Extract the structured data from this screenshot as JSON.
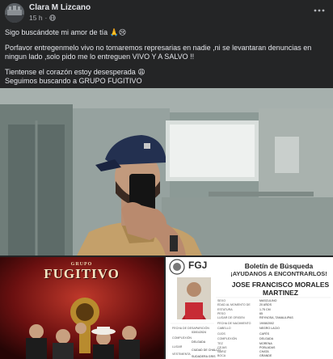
{
  "post": {
    "author": "Clara M Lizcano",
    "time": "15 h",
    "separator": "·",
    "paragraphs": [
      "Sigo buscándote mi amor de tía 🙏😢",
      "Porfavor entregenmelo vivo no tomaremos represarias en nadie ,ni se levantaran denuncias en ningun lado ,solo pido me lo entreguen VIVO Y A SALVO !!",
      "Tientense el corazón estoy desesperada 😩\nSeguimos buscando a GRUPO FUGITIVO"
    ]
  },
  "band_image": {
    "title_top": "GRUPO",
    "title_main": "FUGITIVO"
  },
  "bulletin": {
    "agency": "FGJ",
    "title": "Boletín de Búsqueda",
    "subtitle": "¡AYUDANOS A ENCONTRARLOS!",
    "person_name_line1": "JOSE FRANCISCO MORALES",
    "person_name_line2": "MARTINEZ",
    "fields": [
      {
        "label": "SEXO",
        "value": "MASCULINO"
      },
      {
        "label": "EDAD AL MOMENTO DE",
        "value": "20 AÑOS"
      },
      {
        "label": "ESTATURA",
        "value": "1.75 CM"
      },
      {
        "label": "PESO",
        "value": "65"
      },
      {
        "label": "LUGAR DE ORIGEN",
        "value": "REYNOSA, TAMAULIPAS"
      },
      {
        "label": "FECHA DE NACIMIENTO",
        "value": "19/08/2002"
      },
      {
        "label": "CABELLO",
        "value": "NEGRO LACIO"
      },
      {
        "label": "OJOS",
        "value": "CAFÉS"
      },
      {
        "label": "COMPLEXIÓN",
        "value": "DELGADA"
      },
      {
        "label": "TEZ",
        "value": "MORENA"
      },
      {
        "label": "CEJAS",
        "value": "POBLADAS"
      },
      {
        "label": "NARIZ",
        "value": "CHATA"
      },
      {
        "label": "BOCA",
        "value": "GRANDE"
      }
    ],
    "left_fields": [
      {
        "label": "FECHA DE DESAPARICIÓN",
        "value": "03/01/2024"
      },
      {
        "label": "COMPLEXIÓN",
        "value": "DELGADA"
      },
      {
        "label": "LUGAR",
        "value": "CIUDAD DE CHALCO"
      },
      {
        "label": "VESTIMENTA",
        "value": "SUDADERA GRIS"
      }
    ]
  },
  "colors": {
    "background": "#242526",
    "text": "#e4e6eb",
    "secondary_text": "#b0b3b8",
    "band_red": "#8b1a1a"
  }
}
